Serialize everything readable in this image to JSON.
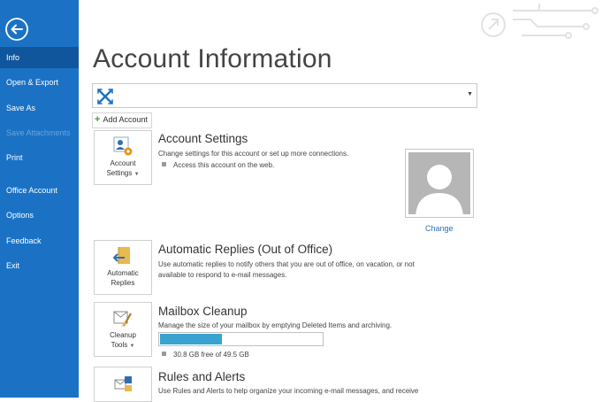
{
  "sidebar": {
    "items": [
      {
        "label": "Info",
        "active": true,
        "disabled": false
      },
      {
        "label": "Open & Export",
        "active": false,
        "disabled": false
      },
      {
        "label": "Save As",
        "active": false,
        "disabled": false
      },
      {
        "label": "Save Attachments",
        "active": false,
        "disabled": true
      },
      {
        "label": "Print",
        "active": false,
        "disabled": false
      },
      {
        "label": "Office Account",
        "active": false,
        "disabled": false
      },
      {
        "label": "Options",
        "active": false,
        "disabled": false
      },
      {
        "label": "Feedback",
        "active": false,
        "disabled": false
      },
      {
        "label": "Exit",
        "active": false,
        "disabled": false
      }
    ]
  },
  "main": {
    "title": "Account Information",
    "account_selector": {
      "value": ""
    },
    "add_account_label": "Add Account",
    "sections": {
      "account_settings": {
        "tile_label_line1": "Account",
        "tile_label_line2": "Settings",
        "title": "Account Settings",
        "description": "Change settings for this account or set up more connections.",
        "bullet": "Access this account on the web."
      },
      "automatic_replies": {
        "tile_label_line1": "Automatic",
        "tile_label_line2": "Replies",
        "title": "Automatic Replies (Out of Office)",
        "description_line1": "Use automatic replies to notify others that you are out of office, on vacation, or not",
        "description_line2": "available to respond to e-mail messages."
      },
      "mailbox_cleanup": {
        "tile_label_line1": "Cleanup",
        "tile_label_line2": "Tools",
        "title": "Mailbox Cleanup",
        "description": "Manage the size of your mailbox by emptying Deleted Items and archiving.",
        "usage_fraction": 0.38,
        "bullet": "30.8 GB free of 49.5 GB"
      },
      "rules_alerts": {
        "title": "Rules and Alerts",
        "description": "Use Rules and Alerts to help organize your incoming e-mail messages, and receive"
      }
    },
    "photo": {
      "change_label": "Change"
    }
  },
  "colors": {
    "sidebar_bg": "#1b72c4",
    "sidebar_active": "#10569c",
    "accent_link": "#2e6fb4",
    "progress_fill": "#38a3cf"
  }
}
